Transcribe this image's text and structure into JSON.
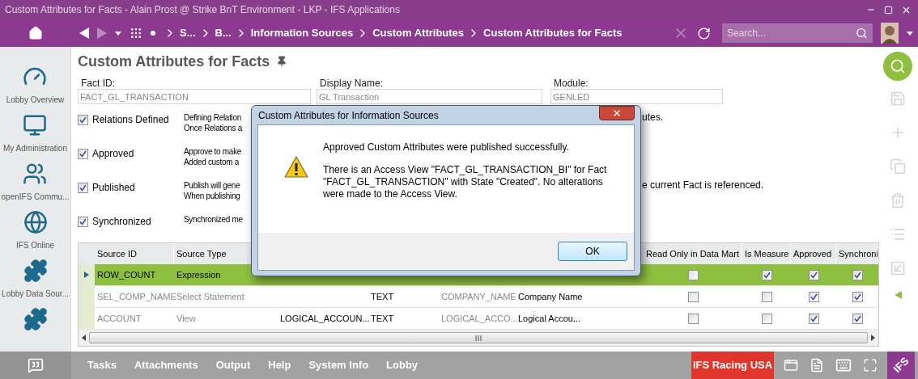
{
  "window": {
    "title": "Custom Attributes for Facts - Alain Prost @ Strike BnT Environment - LKP - IFS Applications"
  },
  "nav": {
    "breadcrumbs": [
      "S...",
      "B...",
      "Information Sources",
      "Custom Attributes",
      "Custom Attributes for Facts"
    ],
    "search": {
      "placeholder": "Search..."
    }
  },
  "sidebar": {
    "items": [
      {
        "kind": "gauge",
        "label": "Lobby Overview"
      },
      {
        "kind": "computer",
        "label": "My Administration"
      },
      {
        "kind": "people",
        "label": "openIFS Commu..."
      },
      {
        "kind": "globe",
        "label": "IFS Online"
      },
      {
        "kind": "puzzle",
        "label": "Lobby Data Sour..."
      },
      {
        "kind": "puzzle"
      }
    ]
  },
  "page": {
    "title": "Custom Attributes for Facts"
  },
  "fields": [
    {
      "label": "Fact ID:",
      "value": "FACT_GL_TRANSACTION"
    },
    {
      "label": "Display Name:",
      "value": "GL Transaction"
    },
    {
      "label": "Module:",
      "value": "GENLED"
    }
  ],
  "statuses": [
    {
      "label": "Relations Defined",
      "checked": true,
      "description_left": [
        "Defining Relation",
        "Once Relations a"
      ],
      "description_right": [
        "utes."
      ]
    },
    {
      "label": "Approved",
      "checked": true,
      "description_left": [
        "Approve to make",
        "Added custom a"
      ]
    },
    {
      "label": "Published",
      "checked": true,
      "description_left": [
        "Publish will gene",
        "When publishing"
      ],
      "description_right": [
        "e current Fact is referenced."
      ]
    },
    {
      "label": "Synchronized",
      "checked": true,
      "description_left": [
        "Synchronized me"
      ]
    }
  ],
  "table": {
    "columns": [
      "Source ID",
      "Source Type"
    ],
    "flag_columns": [
      "Read Only in Data Mart",
      "Is Measure",
      "Approved",
      "Synchroni"
    ],
    "rows": [
      {
        "selected": true,
        "cells": {
          "source_id": "ROW_COUNT",
          "source_type": "Expression"
        },
        "flags": [
          false,
          true,
          true,
          true
        ]
      },
      {
        "selected": false,
        "cells": {
          "source_id": "SEL_COMP_NAME",
          "source_type": "Select Statement",
          "column_4": "TEXT",
          "column_5": "COMPANY_NAME",
          "column_6": "Company Name"
        },
        "flags": [
          false,
          false,
          true,
          true
        ]
      },
      {
        "selected": false,
        "cells": {
          "source_id": "ACCOUNT",
          "source_type": "View",
          "column_3": "LOGICAL_ACCOUN...",
          "column_4": "TEXT",
          "column_5": "LOGICAL_ACCO...",
          "column_6": "Logical Accou..."
        },
        "flags": [
          false,
          false,
          true,
          true
        ]
      }
    ]
  },
  "dialog": {
    "title": "Custom Attributes for Information Sources",
    "messages": [
      "Approved Custom Attributes were published successfully.",
      "There is an Access View \"FACT_GL_TRANSACTION_BI\" for Fact \"FACT_GL_TRANSACTION\" with State \"Created\". No alterations were made to the Access View."
    ],
    "buttons": [
      "OK"
    ]
  },
  "bottom_bar": {
    "tabs": [
      "Tasks",
      "Attachments",
      "Output",
      "Help",
      "System Info",
      "Lobby"
    ],
    "company": "IFS Racing USA",
    "logo": "IFS"
  }
}
